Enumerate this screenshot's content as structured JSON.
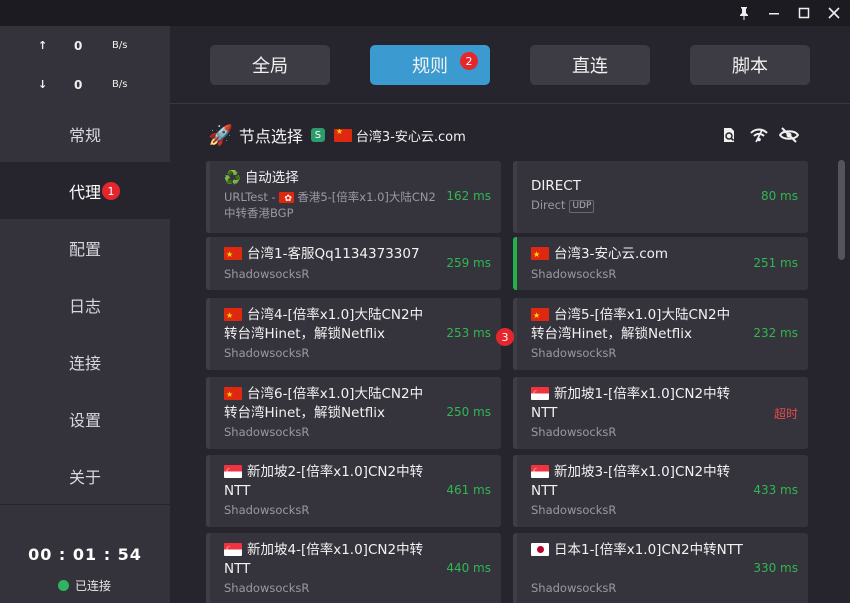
{
  "window": {
    "pin_icon": "pin-icon",
    "minimize_icon": "minimize-icon",
    "maximize_icon": "maximize-icon",
    "close_icon": "close-icon"
  },
  "traffic": {
    "up_arrow": "↑",
    "up_value": "0",
    "up_unit": "B/s",
    "down_arrow": "↓",
    "down_value": "0",
    "down_unit": "B/s"
  },
  "nav": {
    "items": [
      {
        "label": "常规"
      },
      {
        "label": "代理",
        "badge": "1"
      },
      {
        "label": "配置"
      },
      {
        "label": "日志"
      },
      {
        "label": "连接"
      },
      {
        "label": "设置"
      },
      {
        "label": "关于"
      }
    ]
  },
  "footer": {
    "timer": "00 : 01 : 54",
    "status": "已连接",
    "status_color": "#2fb463"
  },
  "modes": [
    {
      "label": "全局"
    },
    {
      "label": "规则",
      "badge": "2"
    },
    {
      "label": "直连"
    },
    {
      "label": "脚本"
    }
  ],
  "group": {
    "icon": "rocket-icon",
    "title": "节点选择",
    "type_tag": "S",
    "current": "台湾3-安心云.com",
    "icons": [
      "latency-test-icon",
      "wifi-icon",
      "hide-icon"
    ]
  },
  "float_badge": "3",
  "proxies": [
    {
      "name": "自动选择",
      "icon": "recycle-icon",
      "sub_prefix": "URLTest - ",
      "sub_flag": "hk",
      "sub": "香港5-[倍率x1.0]大陆CN2中转香港BGP",
      "latency": "162 ms"
    },
    {
      "name": "DIRECT",
      "sub": "Direct",
      "udp": "UDP",
      "latency": "80 ms"
    },
    {
      "name": "台湾1-客服Qq1134373307",
      "flag": "cn",
      "sub": "ShadowsocksR",
      "latency": "259 ms"
    },
    {
      "name": "台湾3-安心云.com",
      "flag": "cn",
      "sub": "ShadowsocksR",
      "latency": "251 ms",
      "selected": true
    },
    {
      "name": "台湾4-[倍率x1.0]大陆CN2中转台湾Hinet，解锁Netflix",
      "flag": "cn",
      "sub": "ShadowsocksR",
      "latency": "253 ms"
    },
    {
      "name": "台湾5-[倍率x1.0]大陆CN2中转台湾Hinet，解锁Netflix",
      "flag": "cn",
      "sub": "ShadowsocksR",
      "latency": "232 ms"
    },
    {
      "name": "台湾6-[倍率x1.0]大陆CN2中转台湾Hinet，解锁Netflix",
      "flag": "cn",
      "sub": "ShadowsocksR",
      "latency": "250 ms"
    },
    {
      "name": "新加坡1-[倍率x1.0]CN2中转NTT",
      "flag": "sg",
      "sub": "ShadowsocksR",
      "latency": "超时",
      "timeout": true
    },
    {
      "name": "新加坡2-[倍率x1.0]CN2中转NTT",
      "flag": "sg",
      "sub": "ShadowsocksR",
      "latency": "461 ms"
    },
    {
      "name": "新加坡3-[倍率x1.0]CN2中转NTT",
      "flag": "sg",
      "sub": "ShadowsocksR",
      "latency": "433 ms"
    },
    {
      "name": "新加坡4-[倍率x1.0]CN2中转NTT",
      "flag": "sg",
      "sub": "ShadowsocksR",
      "latency": "440 ms"
    },
    {
      "name": "日本1-[倍率x1.0]CN2中转NTT",
      "flag": "jp",
      "sub": "ShadowsocksR",
      "latency": "330 ms"
    }
  ],
  "colors": {
    "accent": "#3b9bd1",
    "badge": "#e5262d",
    "latency_ok": "#2fb84f",
    "latency_timeout": "#e24b4b",
    "selected_bar": "#22b14c"
  }
}
